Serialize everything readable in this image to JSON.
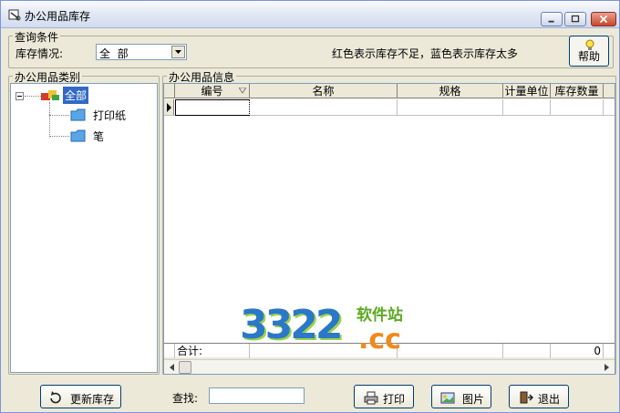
{
  "window": {
    "title": "办公用品库存"
  },
  "query": {
    "group_title": "查询条件",
    "stock_label": "库存情况:",
    "stock_value": "全  部",
    "legend": "红色表示库存不足，蓝色表示库存太多",
    "help_label": "帮助"
  },
  "category": {
    "group_title": "办公用品类别",
    "root": "全部",
    "children": [
      "打印纸",
      "笔"
    ]
  },
  "info": {
    "group_title": "办公用品信息",
    "columns": [
      "编号",
      "名称",
      "规格",
      "计量单位",
      "库存数量"
    ],
    "total_label": "合计:",
    "total_value": "0"
  },
  "toolbar": {
    "refresh_label": "更新库存",
    "search_label": "查找:",
    "search_value": "",
    "print_label": "打印",
    "picture_label": "图片",
    "exit_label": "退出"
  },
  "watermark": {
    "digits": "3322",
    "cn": "软件站",
    "tld": ".cc"
  },
  "colors": {
    "accent": "#316ac5",
    "watermark_blue": "#2b78c8",
    "watermark_orange": "#f08a1a",
    "watermark_green": "#5aa91f"
  }
}
